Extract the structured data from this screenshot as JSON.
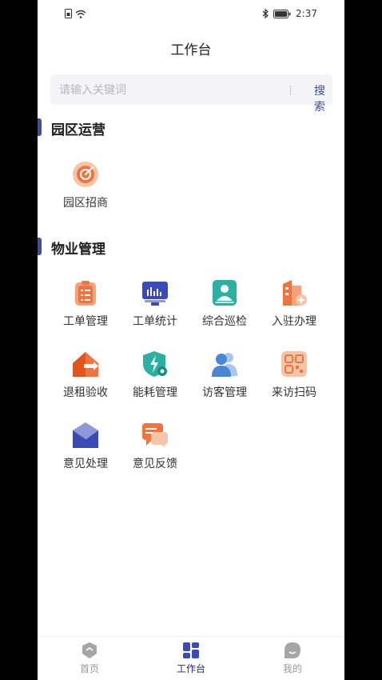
{
  "status_bar": {
    "time": "2:37"
  },
  "header": {
    "title": "工作台"
  },
  "search": {
    "placeholder": "请输入关键词",
    "button_label": "搜索"
  },
  "sections": [
    {
      "title": "园区运营",
      "items": [
        {
          "label": "园区招商",
          "icon": "target-icon"
        }
      ]
    },
    {
      "title": "物业管理",
      "items": [
        {
          "label": "工单管理",
          "icon": "clipboard-icon"
        },
        {
          "label": "工单统计",
          "icon": "monitor-chart-icon"
        },
        {
          "label": "综合巡检",
          "icon": "person-scan-icon"
        },
        {
          "label": "入驻办理",
          "icon": "building-add-icon"
        },
        {
          "label": "退租验收",
          "icon": "house-exit-icon"
        },
        {
          "label": "能耗管理",
          "icon": "energy-shield-icon"
        },
        {
          "label": "访客管理",
          "icon": "visitors-icon"
        },
        {
          "label": "来访扫码",
          "icon": "qr-code-icon"
        },
        {
          "label": "意见处理",
          "icon": "envelope-icon"
        },
        {
          "label": "意见反馈",
          "icon": "chat-bubble-icon"
        }
      ]
    }
  ],
  "tabbar": {
    "tabs": [
      {
        "label": "首页",
        "icon": "home-shield-icon"
      },
      {
        "label": "工作台",
        "icon": "grid-icon",
        "active": true
      },
      {
        "label": "我的",
        "icon": "profile-icon"
      }
    ]
  },
  "colors": {
    "accent": "#3e4ba8",
    "orange": "#f0743f",
    "blue": "#3c4ab5",
    "teal": "#2bb0a3"
  }
}
